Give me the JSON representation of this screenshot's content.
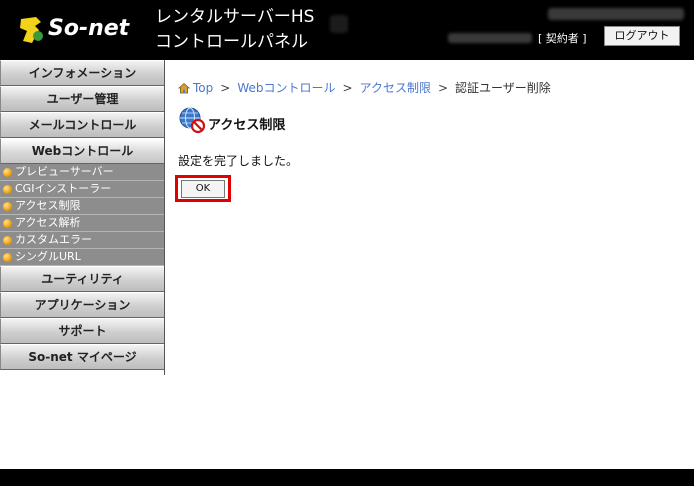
{
  "header": {
    "logo_text": "So-net",
    "title_line1": "レンタルサーバーHS",
    "title_line2": "コントロールパネル",
    "contract_label": "[ 契約者 ]",
    "logout_label": "ログアウト"
  },
  "sidebar": {
    "sections": [
      {
        "label": "インフォメーション"
      },
      {
        "label": "ユーザー管理"
      },
      {
        "label": "メールコントロール"
      },
      {
        "label": "Webコントロール"
      }
    ],
    "web_items": [
      {
        "label": "プレビューサーバー"
      },
      {
        "label": "CGIインストーラー"
      },
      {
        "label": "アクセス制限"
      },
      {
        "label": "アクセス解析"
      },
      {
        "label": "カスタムエラー"
      },
      {
        "label": "シングルURL"
      }
    ],
    "more_sections": [
      {
        "label": "ユーティリティ"
      },
      {
        "label": "アプリケーション"
      },
      {
        "label": "サポート"
      },
      {
        "label": "So-net マイページ"
      }
    ]
  },
  "breadcrumb": {
    "top": "Top",
    "web_control": "Webコントロール",
    "access_limit": "アクセス制限",
    "current": "認証ユーザー削除",
    "separator": ">"
  },
  "main": {
    "page_title": "アクセス制限",
    "message": "設定を完了しました。",
    "ok_label": "OK"
  },
  "icons": {
    "logo": "so-net-logo-icon",
    "home": "home-icon",
    "page": "globe-prohibited-icon",
    "bullet": "orange-bullet-icon"
  },
  "colors": {
    "header_bg": "#000000",
    "link": "#4a77d0",
    "highlight": "#e00000",
    "submenu_bg": "#8d8d8d"
  }
}
